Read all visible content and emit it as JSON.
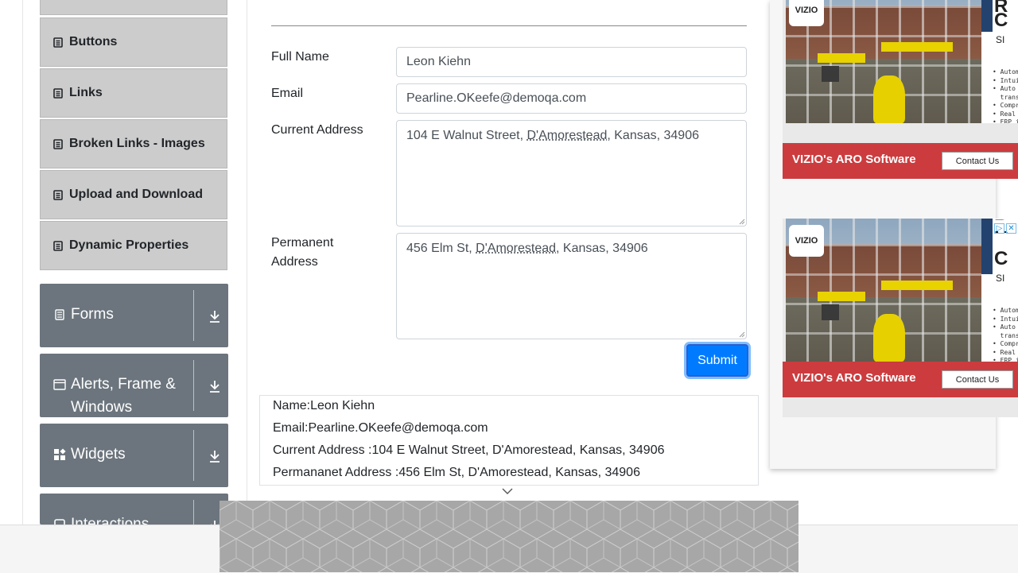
{
  "sidebar": {
    "elements_items": [
      {
        "label": ""
      },
      {
        "label": "Buttons"
      },
      {
        "label": "Links"
      },
      {
        "label": "Broken Links - Images"
      },
      {
        "label": "Upload and Download"
      },
      {
        "label": "Dynamic Properties"
      }
    ],
    "groups": [
      {
        "label": "Forms",
        "icon": "form-icon"
      },
      {
        "label": "Alerts, Frame & Windows",
        "line1": "Alerts, Frame &",
        "line2": "Windows",
        "icon": "window-icon"
      },
      {
        "label": "Widgets",
        "icon": "widgets-icon"
      },
      {
        "label": "Interactions",
        "icon": "interactions-icon"
      }
    ]
  },
  "form": {
    "full_name_label": "Full Name",
    "full_name_value": "Leon Kiehn",
    "email_label": "Email",
    "email_value": "Pearline.OKeefe@demoqa.com",
    "current_address_label": "Current Address",
    "current_address_parts": [
      "104 E Walnut Street, ",
      "D'Amorestead",
      ", Kansas, 34906"
    ],
    "permanent_address_label_1": "Permanent",
    "permanent_address_label_2": "Address",
    "permanent_address_parts": [
      "456 Elm St, ",
      "D'Amorestead",
      ", Kansas, 34906"
    ],
    "submit_label": "Submit"
  },
  "output": {
    "name": "Name:Leon Kiehn",
    "email": "Email:Pearline.OKeefe@demoqa.com",
    "current_address": "Current Address :104 E Walnut Street, D'Amorestead, Kansas, 34906",
    "permanent_address": "Permananet Address :456 Elm St, D'Amorestead, Kansas, 34906"
  },
  "ads": {
    "logo": "VIZIO",
    "headline_letters": [
      "R",
      "C"
    ],
    "subtext": "SI",
    "bullets": "• Automa\n• Intuit\n• Auto g\n  transa\n• Compre\n• Real t\n• ERP in\n• Custom",
    "banner_text": "VIZIO's ARO Software",
    "contact_label": "Contact Us",
    "adchoices_icon": "▷",
    "close_icon": "✕"
  },
  "colors": {
    "accent": "#007bff",
    "sidebar_group": "#6c757d",
    "sidebar_item": "#cccccc",
    "ad_banner": "#cc3c3f"
  }
}
